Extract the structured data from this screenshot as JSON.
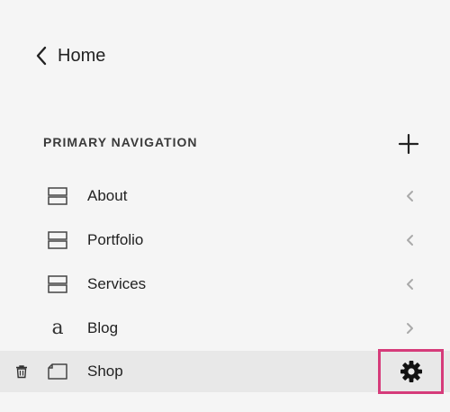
{
  "back_link": {
    "label": "Home",
    "icon": "chevron-left-icon"
  },
  "section": {
    "title": "PRIMARY NAVIGATION",
    "add_icon": "plus-icon"
  },
  "nav_items": [
    {
      "label": "About",
      "icon": "layout-page-icon",
      "arrow": "chevron-left-icon"
    },
    {
      "label": "Portfolio",
      "icon": "layout-page-icon",
      "arrow": "chevron-left-icon"
    },
    {
      "label": "Services",
      "icon": "layout-page-icon",
      "arrow": "chevron-left-icon"
    },
    {
      "label": "Blog",
      "icon": "blog-icon",
      "glyph": "a",
      "arrow": "chevron-right-icon"
    },
    {
      "label": "Shop",
      "icon": "store-page-icon",
      "actions": [
        "trash-icon",
        "gear-icon"
      ],
      "selected": true
    }
  ],
  "colors": {
    "highlight": "#d63b7a",
    "row_selected": "#e8e8e8",
    "background": "#f5f5f5"
  }
}
